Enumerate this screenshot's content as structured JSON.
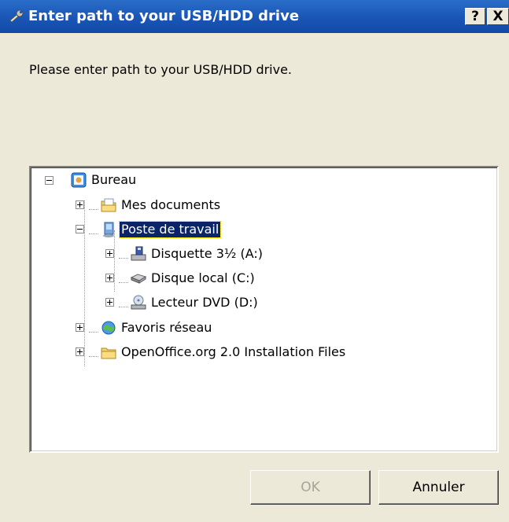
{
  "window": {
    "title": "Enter path to your USB/HDD drive",
    "help_label": "?",
    "close_label": "X"
  },
  "prompt": "Please enter path to your USB/HDD drive.",
  "tree": {
    "root": {
      "label": "Bureau",
      "state": "collapsible"
    },
    "items": [
      {
        "label": "Mes documents",
        "icon": "documents-folder-icon"
      },
      {
        "label": "Poste de travail",
        "icon": "computer-icon",
        "selected": true
      },
      {
        "label": "Disquette 3½ (A:)",
        "icon": "floppy-drive-icon"
      },
      {
        "label": "Disque local (C:)",
        "icon": "hard-drive-icon"
      },
      {
        "label": "Lecteur DVD (D:)",
        "icon": "dvd-drive-icon"
      },
      {
        "label": "Favoris réseau",
        "icon": "network-places-icon"
      },
      {
        "label": "OpenOffice.org 2.0 Installation Files",
        "icon": "folder-icon"
      }
    ]
  },
  "buttons": {
    "ok": "OK",
    "cancel": "Annuler"
  },
  "colors": {
    "titlebar": "#1B57B8",
    "selection": "#0A246A",
    "dialog_bg": "#ECE9D8"
  }
}
